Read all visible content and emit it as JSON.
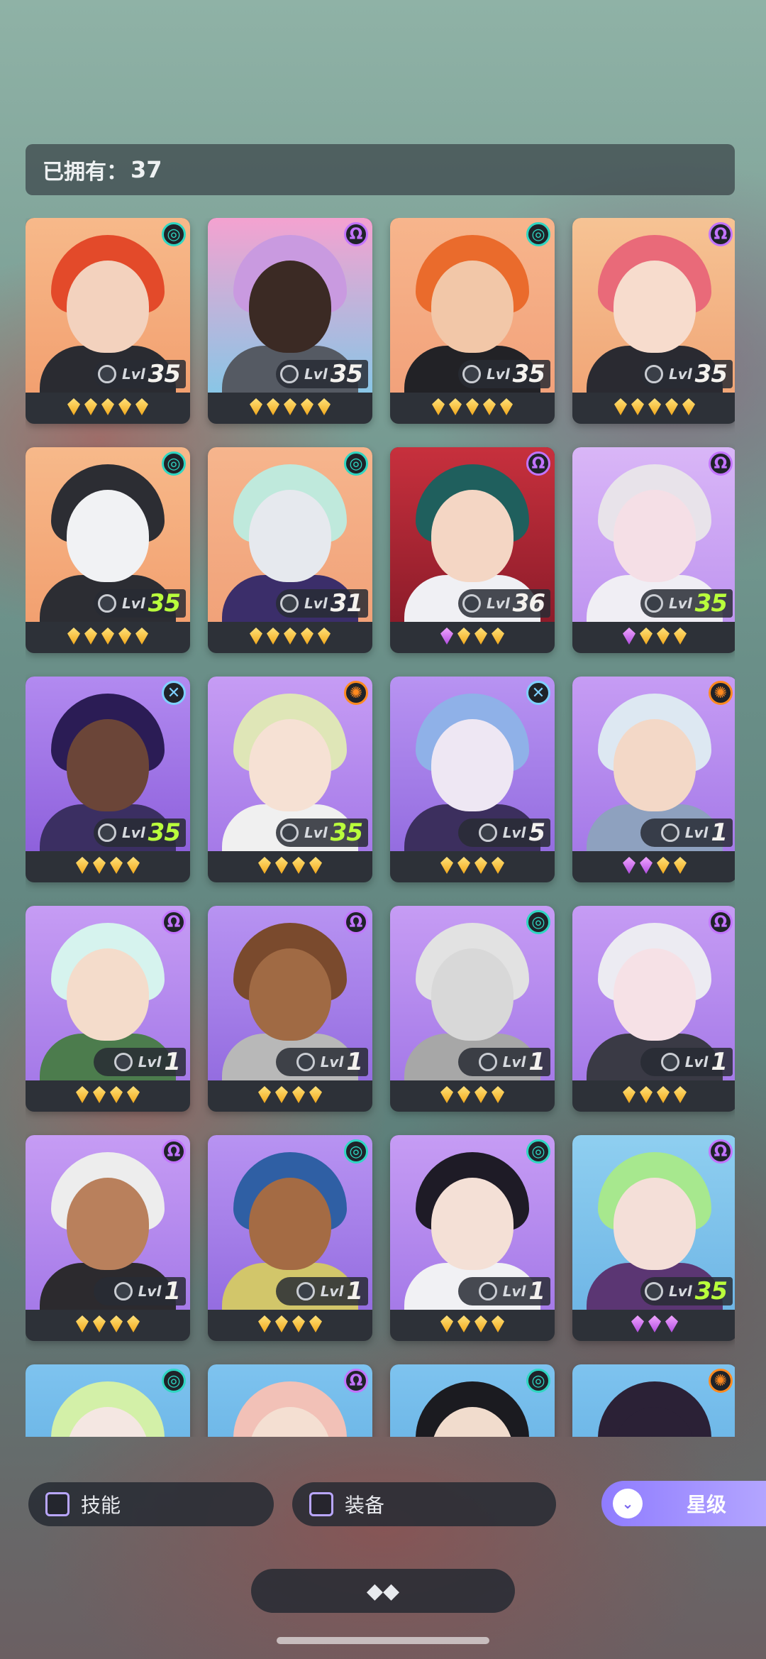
{
  "header": {
    "owned_label": "已拥有：",
    "owned_count": "37"
  },
  "level_prefix": "Lvl",
  "colors": {
    "lvl_gold": "#f4f2ee",
    "lvl_green": "#b9ff3c"
  },
  "heroes": [
    {
      "elem": "swirl",
      "lvl": "35",
      "green": false,
      "stars": [
        "g",
        "g",
        "g",
        "g",
        "g"
      ],
      "bg": [
        "#f7b98a",
        "#f2a070"
      ],
      "hair": "#e34a2a",
      "skin": "#f3d2be",
      "outfit": "#2a2b31"
    },
    {
      "elem": "omega",
      "lvl": "35",
      "green": false,
      "stars": [
        "g",
        "g",
        "g",
        "g",
        "g"
      ],
      "bg": [
        "#f4a2d0",
        "#89c6e6"
      ],
      "hair": "#c99ae0",
      "skin": "#3b2a24",
      "outfit": "#555a63"
    },
    {
      "elem": "swirl",
      "lvl": "35",
      "green": false,
      "stars": [
        "g",
        "g",
        "g",
        "g",
        "g"
      ],
      "bg": [
        "#f7b58c",
        "#f2a27b"
      ],
      "hair": "#ea6b2c",
      "skin": "#f2c7a8",
      "outfit": "#222226"
    },
    {
      "elem": "omega",
      "lvl": "35",
      "green": false,
      "stars": [
        "g",
        "g",
        "g",
        "g",
        "g"
      ],
      "bg": [
        "#f6c394",
        "#f1a677"
      ],
      "hair": "#e96a79",
      "skin": "#f7dccd",
      "outfit": "#2a2a31"
    },
    {
      "elem": "swirl",
      "lvl": "35",
      "green": true,
      "stars": [
        "g",
        "g",
        "g",
        "g",
        "g"
      ],
      "bg": [
        "#f7b98a",
        "#f2a070"
      ],
      "hair": "#2c2d33",
      "skin": "#f1f2f4",
      "outfit": "#2c2d33"
    },
    {
      "elem": "swirl",
      "lvl": "31",
      "green": false,
      "stars": [
        "g",
        "g",
        "g",
        "g",
        "g"
      ],
      "bg": [
        "#f6b58d",
        "#f1a279"
      ],
      "hair": "#bfe9dc",
      "skin": "#e6e9ee",
      "outfit": "#3b2e6a"
    },
    {
      "elem": "omega",
      "lvl": "36",
      "green": false,
      "stars": [
        "p",
        "g",
        "g",
        "g"
      ],
      "bg": [
        "#c7303d",
        "#8d1c2a"
      ],
      "hair": "#1f5f5d",
      "skin": "#f4d6c4",
      "outfit": "#f0f0f4"
    },
    {
      "elem": "omega",
      "lvl": "35",
      "green": true,
      "stars": [
        "p",
        "g",
        "g",
        "g"
      ],
      "bg": [
        "#d9b6f7",
        "#bf95f0"
      ],
      "hair": "#e8e3ea",
      "skin": "#f5dfe6",
      "outfit": "#f0eef4"
    },
    {
      "elem": "cross",
      "lvl": "35",
      "green": true,
      "stars": [
        "g",
        "g",
        "g",
        "g"
      ],
      "bg": [
        "#b28af0",
        "#8e61dc"
      ],
      "hair": "#2b1c55",
      "skin": "#6b4538",
      "outfit": "#3b2f62"
    },
    {
      "elem": "sun",
      "lvl": "35",
      "green": true,
      "stars": [
        "g",
        "g",
        "g",
        "g"
      ],
      "bg": [
        "#c69cf4",
        "#a57ae8"
      ],
      "hair": "#dfe6b7",
      "skin": "#f6e1d4",
      "outfit": "#f0f0f0"
    },
    {
      "elem": "cross",
      "lvl": "5",
      "green": false,
      "stars": [
        "g",
        "g",
        "g",
        "g"
      ],
      "bg": [
        "#b893f2",
        "#946de0"
      ],
      "hair": "#8fb1e8",
      "skin": "#eee7f3",
      "outfit": "#3c2f5e"
    },
    {
      "elem": "sun",
      "lvl": "1",
      "green": false,
      "stars": [
        "p",
        "p",
        "g",
        "g"
      ],
      "bg": [
        "#c69cf4",
        "#a57ae8"
      ],
      "hair": "#dde8f2",
      "skin": "#f3d8c7",
      "outfit": "#8ea1bf"
    },
    {
      "elem": "omega",
      "lvl": "1",
      "green": false,
      "stars": [
        "g",
        "g",
        "g",
        "g"
      ],
      "bg": [
        "#c69cf4",
        "#a57ae8"
      ],
      "hair": "#d6f3ee",
      "skin": "#f4dccb",
      "outfit": "#4c7c4d"
    },
    {
      "elem": "omega",
      "lvl": "1",
      "green": false,
      "stars": [
        "g",
        "g",
        "g",
        "g"
      ],
      "bg": [
        "#b893f2",
        "#946de0"
      ],
      "hair": "#7a4a2d",
      "skin": "#a06a44",
      "outfit": "#b8b8b8"
    },
    {
      "elem": "swirl",
      "lvl": "1",
      "green": false,
      "stars": [
        "g",
        "g",
        "g",
        "g"
      ],
      "bg": [
        "#c69cf4",
        "#a57ae8"
      ],
      "hair": "#e2e2e2",
      "skin": "#d8d8d8",
      "outfit": "#a7a7a7"
    },
    {
      "elem": "omega",
      "lvl": "1",
      "green": false,
      "stars": [
        "g",
        "g",
        "g",
        "g"
      ],
      "bg": [
        "#c69cf4",
        "#a57ae8"
      ],
      "hair": "#ecebf2",
      "skin": "#f6e1e6",
      "outfit": "#3a3a45"
    },
    {
      "elem": "omega",
      "lvl": "1",
      "green": false,
      "stars": [
        "g",
        "g",
        "g",
        "g"
      ],
      "bg": [
        "#c69cf4",
        "#a57ae8"
      ],
      "hair": "#ededed",
      "skin": "#b9805c",
      "outfit": "#2c2a2e"
    },
    {
      "elem": "swirl",
      "lvl": "1",
      "green": false,
      "stars": [
        "g",
        "g",
        "g",
        "g"
      ],
      "bg": [
        "#b893f2",
        "#946de0"
      ],
      "hair": "#2f5fa4",
      "skin": "#a46b44",
      "outfit": "#d2c66a"
    },
    {
      "elem": "swirl",
      "lvl": "1",
      "green": false,
      "stars": [
        "g",
        "g",
        "g",
        "g"
      ],
      "bg": [
        "#c69cf4",
        "#a57ae8"
      ],
      "hair": "#1e1b26",
      "skin": "#f4e0d6",
      "outfit": "#f1f1f4"
    },
    {
      "elem": "omega",
      "lvl": "35",
      "green": true,
      "stars": [
        "p",
        "p",
        "p"
      ],
      "bg": [
        "#8fcff0",
        "#6fb6e6"
      ],
      "hair": "#a7e88e",
      "skin": "#f4dfd8",
      "outfit": "#5b3673"
    },
    {
      "elem": "swirl",
      "lvl": "",
      "green": false,
      "stars": [],
      "bg": [
        "#7ec3ef",
        "#5aa9de"
      ],
      "hair": "#d3f0a8",
      "skin": "#f4e7e2",
      "outfit": "#6c8f6a"
    },
    {
      "elem": "omega",
      "lvl": "",
      "green": false,
      "stars": [],
      "bg": [
        "#7ec3ef",
        "#5aa9de"
      ],
      "hair": "#f2c1b7",
      "skin": "#f4dfd2",
      "outfit": "#b08b70"
    },
    {
      "elem": "swirl",
      "lvl": "",
      "green": false,
      "stars": [],
      "bg": [
        "#7ec3ef",
        "#5aa9de"
      ],
      "hair": "#1b1b20",
      "skin": "#f1dccd",
      "outfit": "#2b2b30"
    },
    {
      "elem": "sun",
      "lvl": "",
      "green": false,
      "stars": [],
      "bg": [
        "#7ec3ef",
        "#5aa9de"
      ],
      "hair": "#2b2136",
      "skin": "#2b2136",
      "outfit": "#2b2136"
    }
  ],
  "filters": {
    "skill_label": "技能",
    "equipment_label": "装备"
  },
  "sort": {
    "label": "星级"
  },
  "collapse": {
    "label": "◆◆"
  }
}
